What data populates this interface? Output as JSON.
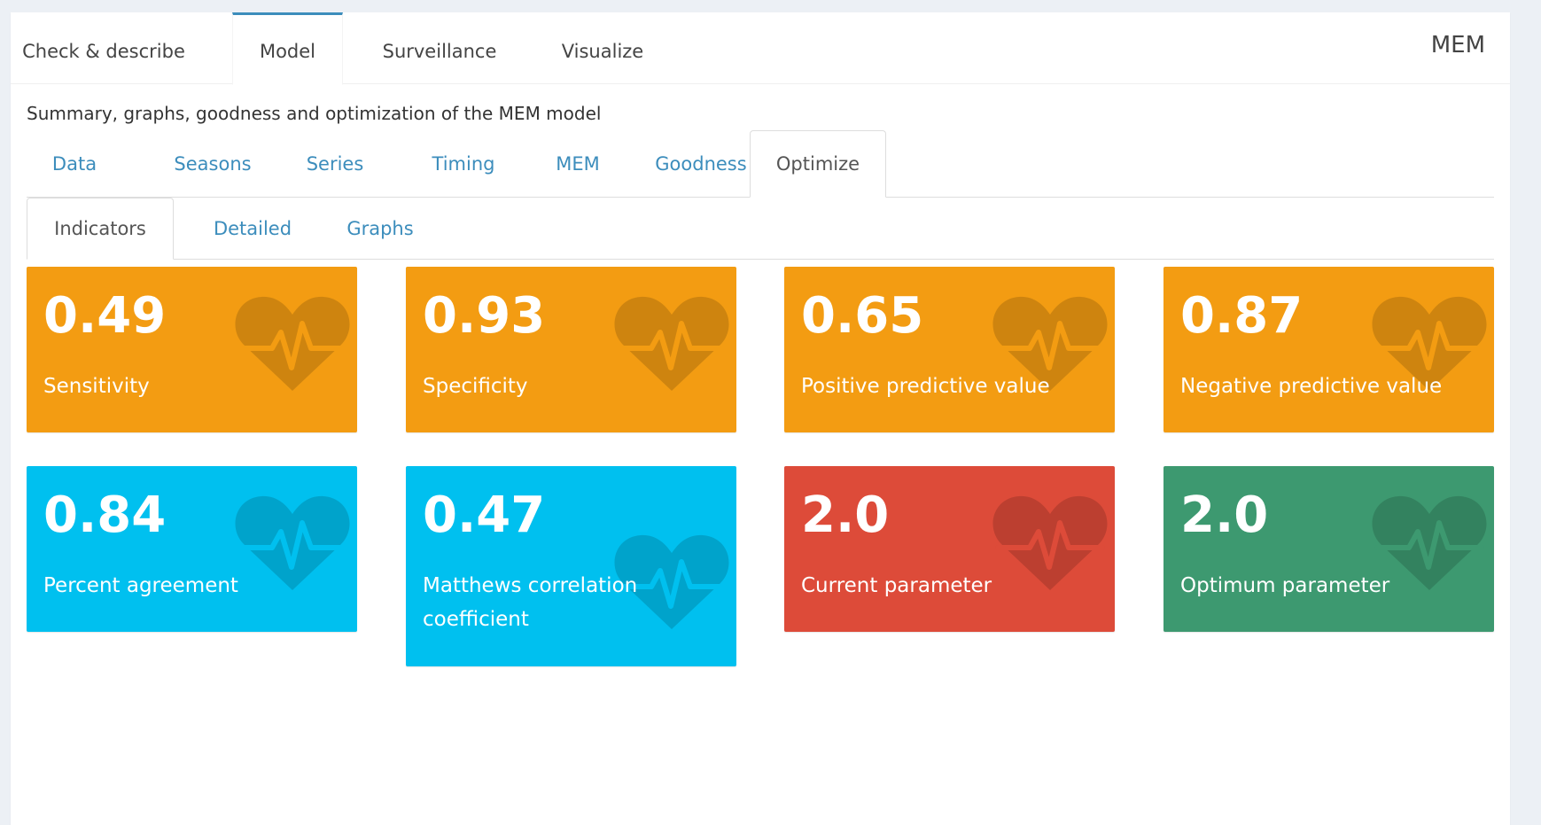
{
  "app": {
    "brand": "MEM",
    "top_tabs": [
      {
        "label": "Check & describe"
      },
      {
        "label": "Model"
      },
      {
        "label": "Surveillance"
      },
      {
        "label": "Visualize"
      }
    ],
    "active_top_tab": "Model"
  },
  "model": {
    "subtitle": "Summary, graphs, goodness and optimization of the MEM model",
    "tabs": [
      {
        "label": "Data"
      },
      {
        "label": "Seasons"
      },
      {
        "label": "Series"
      },
      {
        "label": "Timing"
      },
      {
        "label": "MEM"
      },
      {
        "label": "Goodness"
      },
      {
        "label": "Optimize"
      }
    ],
    "active_tab": "Optimize"
  },
  "optimize": {
    "tabs": [
      {
        "label": "Indicators"
      },
      {
        "label": "Detailed"
      },
      {
        "label": "Graphs"
      }
    ],
    "active_tab": "Indicators"
  },
  "indicators": [
    {
      "value": "0.49",
      "label": "Sensitivity",
      "color": "#f39c12",
      "icon": "heartbeat-icon"
    },
    {
      "value": "0.93",
      "label": "Specificity",
      "color": "#f39c12",
      "icon": "heartbeat-icon"
    },
    {
      "value": "0.65",
      "label": "Positive predictive value",
      "color": "#f39c12",
      "icon": "heartbeat-icon"
    },
    {
      "value": "0.87",
      "label": "Negative predictive value",
      "color": "#f39c12",
      "icon": "heartbeat-icon"
    },
    {
      "value": "0.84",
      "label": "Percent agreement",
      "color": "#00c0ef",
      "icon": "heartbeat-icon"
    },
    {
      "value": "0.47",
      "label": "Matthews correlation coefficient",
      "color": "#00c0ef",
      "icon": "heartbeat-icon"
    },
    {
      "value": "2.0",
      "label": "Current parameter",
      "color": "#dd4b39",
      "icon": "heartbeat-icon"
    },
    {
      "value": "2.0",
      "label": "Optimum parameter",
      "color": "#3d9970",
      "icon": "heartbeat-icon"
    }
  ]
}
